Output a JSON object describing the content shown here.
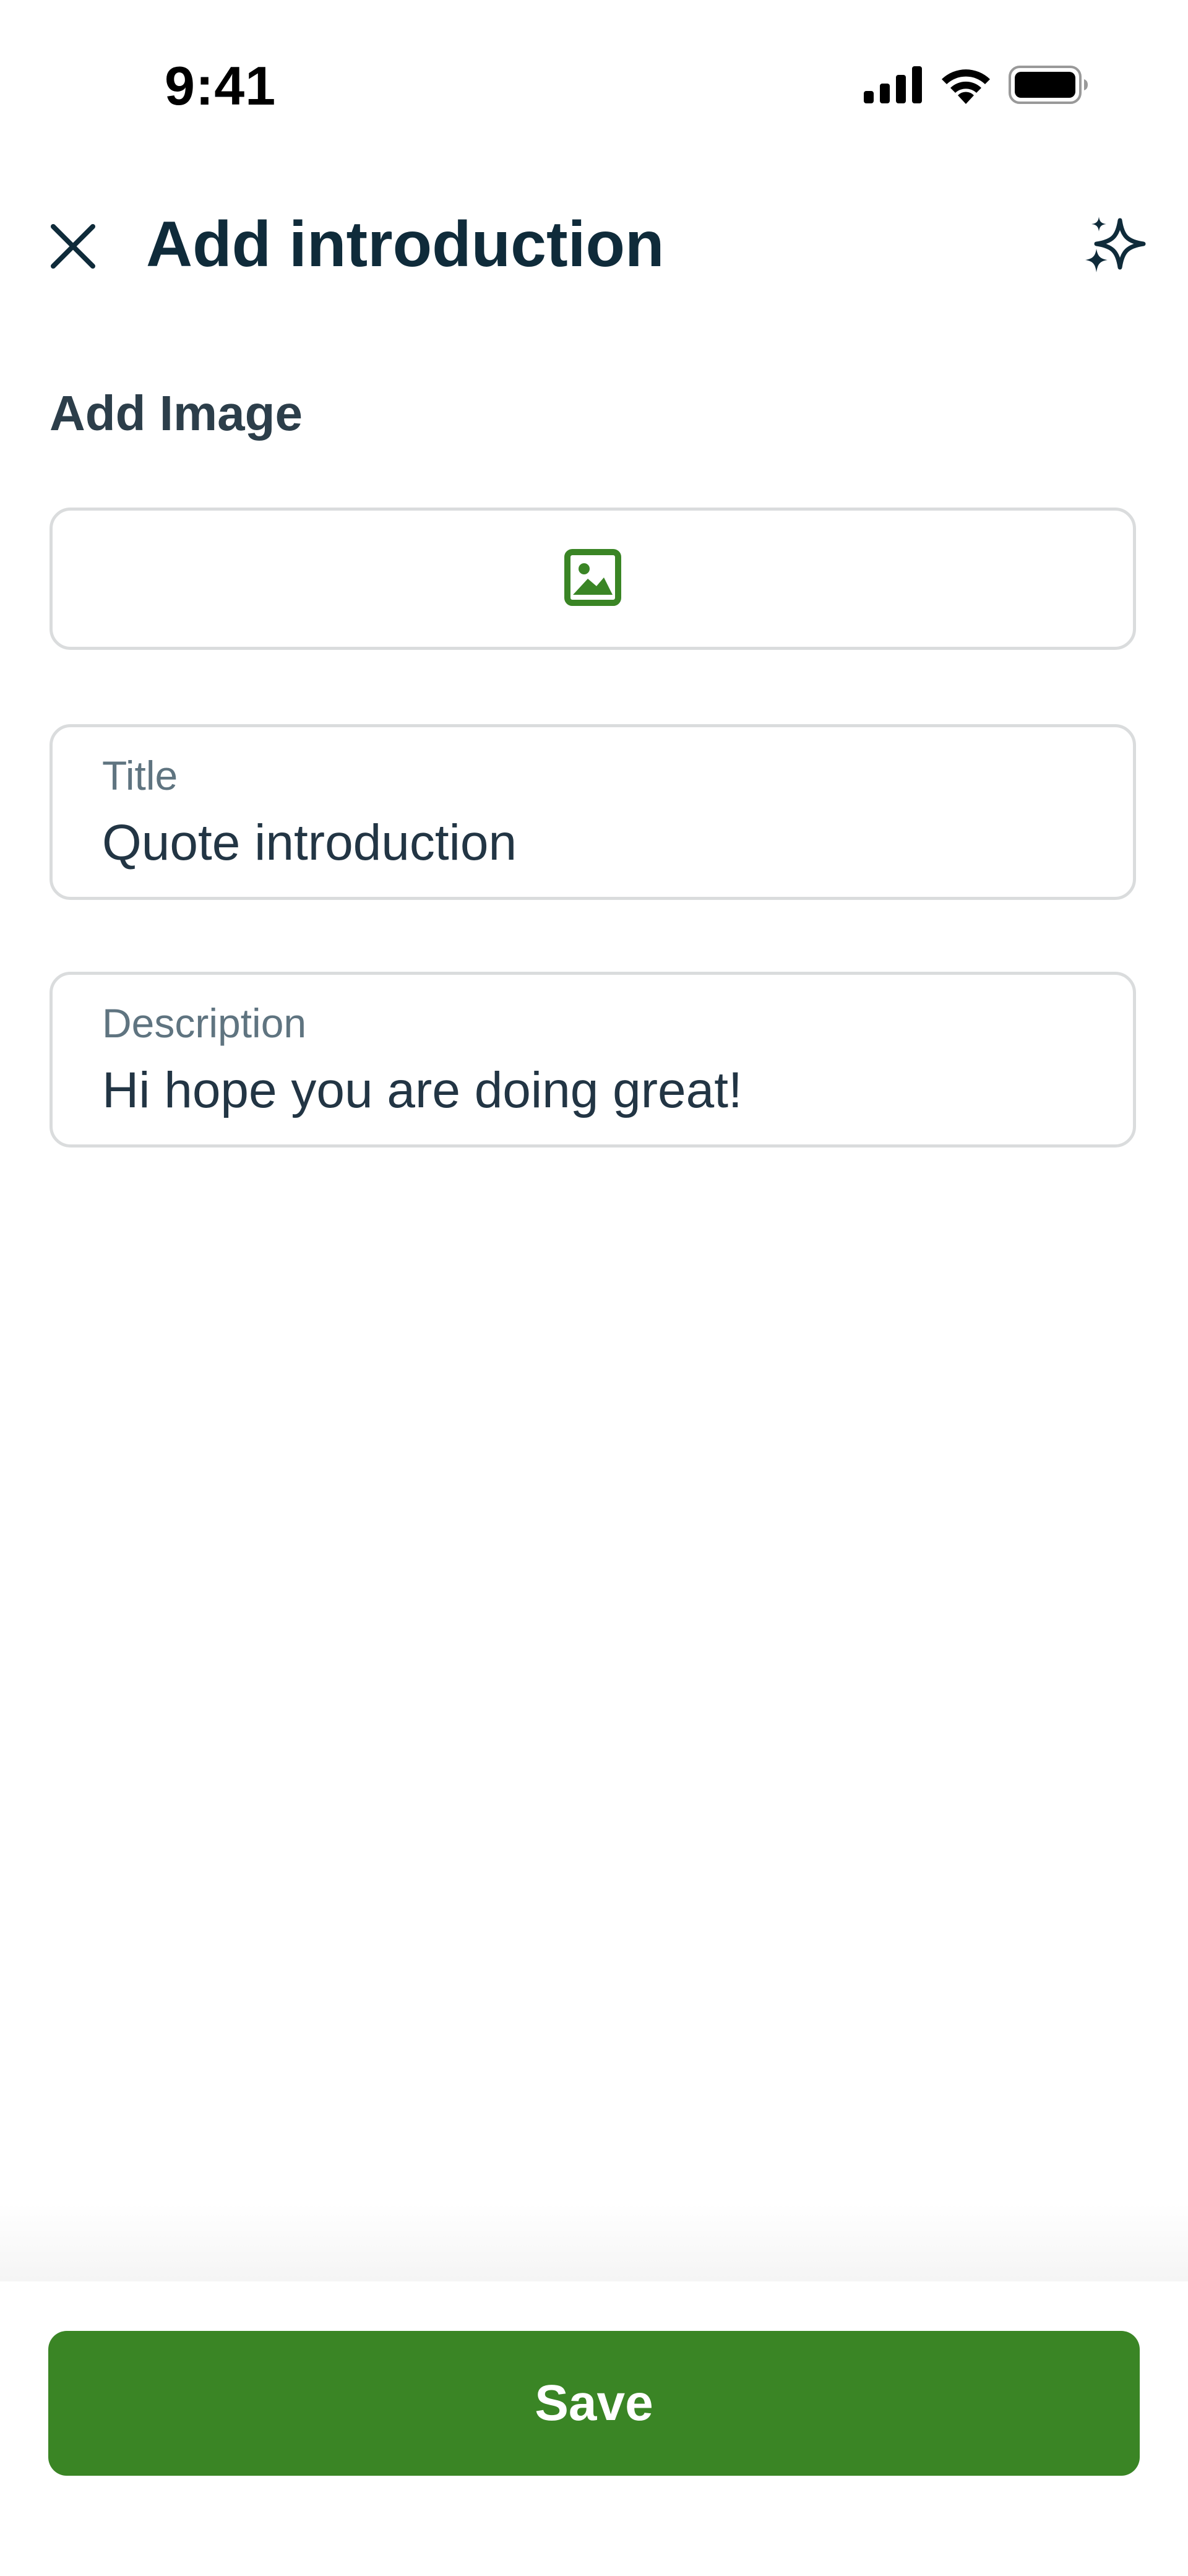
{
  "status_bar": {
    "time": "9:41",
    "icons": [
      "cellular-signal-icon",
      "wifi-icon",
      "battery-icon"
    ]
  },
  "header": {
    "title": "Add introduction",
    "close_icon": "close-icon",
    "action_icon": "sparkles-icon"
  },
  "image_section": {
    "label": "Add Image",
    "icon": "image-icon"
  },
  "fields": {
    "title": {
      "label": "Title",
      "value": "Quote introduction"
    },
    "description": {
      "label": "Description",
      "value": "Hi hope you are doing great!"
    }
  },
  "footer": {
    "save_label": "Save"
  },
  "colors": {
    "primary": "#3a8525",
    "title_text": "#0f2b3a",
    "field_border": "#dadcdd",
    "label_text": "#5f7480"
  }
}
